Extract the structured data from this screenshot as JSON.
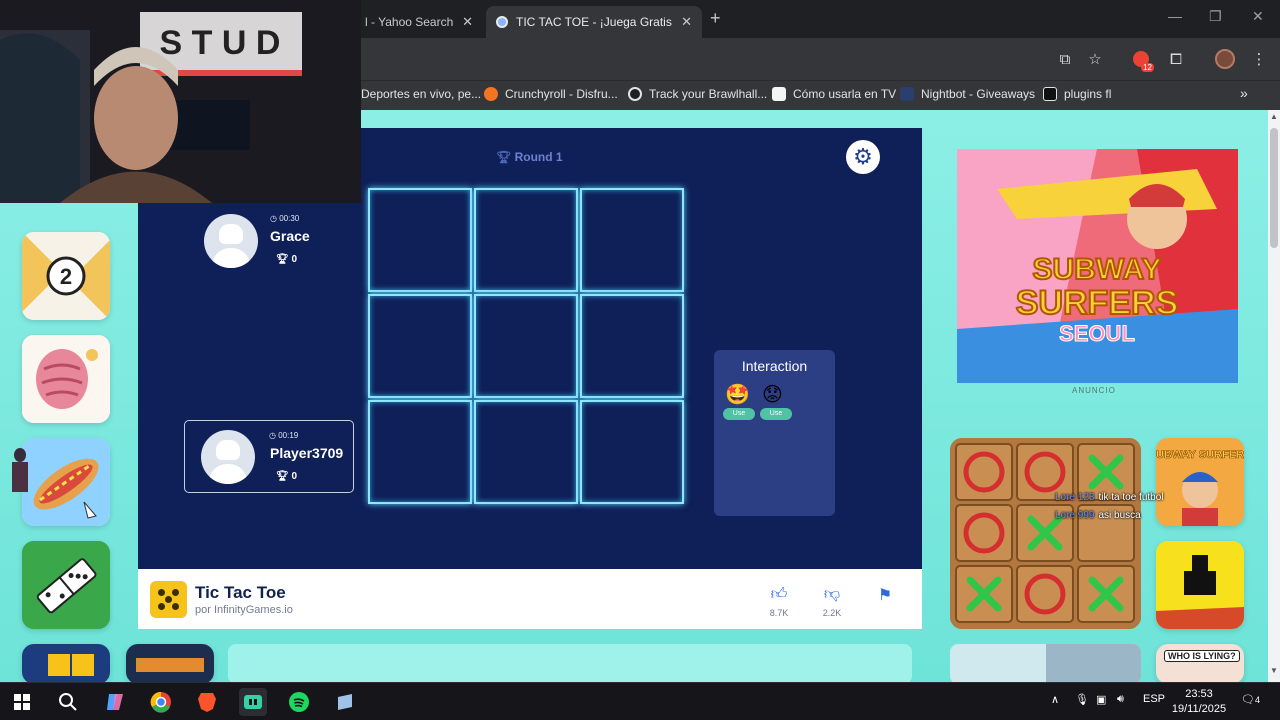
{
  "browser": {
    "tabs": [
      {
        "title": "l - Yahoo Search",
        "active": false
      },
      {
        "title": "TIC TAC TOE - ¡Juega Gratis Onli",
        "active": true
      }
    ],
    "new_tab_label": "+",
    "extension_badge": "12",
    "bookmarks": [
      {
        "label": "Deportes en vivo, pe...",
        "icon": "globe-icon"
      },
      {
        "label": "Crunchyroll - Disfru...",
        "icon": "crunchyroll-icon"
      },
      {
        "label": "Track your Brawlhall...",
        "icon": "brawlhalla-icon"
      },
      {
        "label": "Cómo usarla en TV",
        "icon": "bookmark-page-icon"
      },
      {
        "label": "Nightbot - Giveaways",
        "icon": "nightbot-icon"
      },
      {
        "label": "plugins fl",
        "icon": "fl-icon"
      }
    ],
    "more_bookmarks": "»"
  },
  "game": {
    "round_label": "Round 1",
    "players": [
      {
        "name": "Grace",
        "time": "00:30",
        "score": "0"
      },
      {
        "name": "Player3709",
        "time": "00:19",
        "score": "0"
      }
    ],
    "interaction": {
      "title": "Interaction",
      "emojis": [
        {
          "icon": "star-struck-emoji-icon",
          "glyph": "🤩",
          "button": "Use"
        },
        {
          "icon": "worried-emoji-icon",
          "glyph": "😟",
          "button": "Use"
        }
      ]
    },
    "info": {
      "title": "Tic Tac Toe",
      "author": "por InfinityGames.io",
      "likes": "8.7K",
      "dislikes": "2.2K"
    }
  },
  "ad": {
    "title_line1": "SUBWAY",
    "title_line2": "SURFERS",
    "title_line3": "SEOUL",
    "label": "ANUNCIO"
  },
  "sidebar_games": [
    {
      "icon": "number-puzzle-icon",
      "text": "2"
    },
    {
      "icon": "brain-game-icon"
    },
    {
      "icon": "hotdog-game-icon"
    },
    {
      "icon": "dominoes-game-icon"
    }
  ],
  "right_thumbs": [
    {
      "icon": "subway-surfers-thumb-icon",
      "text": "SUBWAY SURFERS"
    },
    {
      "icon": "silhouette-game-icon"
    },
    {
      "icon": "who-is-lying-icon",
      "text": "WHO IS LYING?"
    }
  ],
  "chat": [
    {
      "user": "Lore 123",
      "message": "tik ta toe futbol"
    },
    {
      "user": "Lore 999",
      "message": "asi busca"
    }
  ],
  "taskbar": {
    "language": "ESP",
    "time": "23:53",
    "date": "19/11/2025",
    "notifications": "4"
  }
}
